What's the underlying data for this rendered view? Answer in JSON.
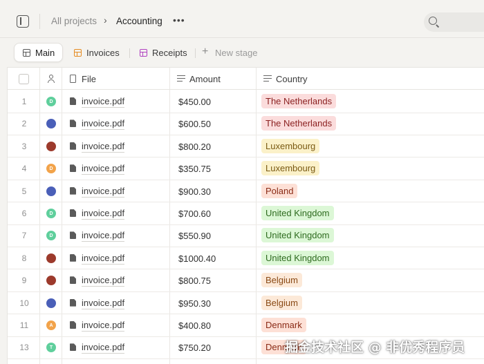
{
  "header": {
    "breadcrumb_root": "All projects",
    "breadcrumb_sep": "›",
    "breadcrumb_current": "Accounting",
    "more_glyph": "•••"
  },
  "tabs": [
    {
      "label": "Main",
      "active": true,
      "icon": "table-icon",
      "color": "#555555"
    },
    {
      "label": "Invoices",
      "active": false,
      "icon": "table-icon",
      "color": "#e58a1f"
    },
    {
      "label": "Receipts",
      "active": false,
      "icon": "table-icon",
      "color": "#b03fc0"
    }
  ],
  "new_stage": {
    "glyph": "+",
    "label": "New stage"
  },
  "columns": {
    "file": "File",
    "amount": "Amount",
    "country": "Country"
  },
  "rows": [
    {
      "num": "1",
      "initial": "D",
      "avatar_color": "#5fcf9c",
      "file": "invoice.pdf",
      "amount": "$450.00",
      "country": "The Netherlands",
      "bg": "#fbdcdc",
      "fg": "#8a1f1f"
    },
    {
      "num": "2",
      "initial": "",
      "avatar_color": "#4a5fb8",
      "file": "invoice.pdf",
      "amount": "$600.50",
      "country": "The Netherlands",
      "bg": "#fbdcdc",
      "fg": "#8a1f1f"
    },
    {
      "num": "3",
      "initial": "",
      "avatar_color": "#9c3a2c",
      "file": "invoice.pdf",
      "amount": "$800.20",
      "country": "Luxembourg",
      "bg": "#fbf1c9",
      "fg": "#7a5a12"
    },
    {
      "num": "4",
      "initial": "D",
      "avatar_color": "#f2a34a",
      "file": "invoice.pdf",
      "amount": "$350.75",
      "country": "Luxembourg",
      "bg": "#fbf1c9",
      "fg": "#7a5a12"
    },
    {
      "num": "5",
      "initial": "",
      "avatar_color": "#4a5fb8",
      "file": "invoice.pdf",
      "amount": "$900.30",
      "country": "Poland",
      "bg": "#fde0d6",
      "fg": "#8a2a15"
    },
    {
      "num": "6",
      "initial": "D",
      "avatar_color": "#5fcf9c",
      "file": "invoice.pdf",
      "amount": "$700.60",
      "country": "United Kingdom",
      "bg": "#dcf7d6",
      "fg": "#2e6b1f"
    },
    {
      "num": "7",
      "initial": "D",
      "avatar_color": "#5fcf9c",
      "file": "invoice.pdf",
      "amount": "$550.90",
      "country": "United Kingdom",
      "bg": "#dcf7d6",
      "fg": "#2e6b1f"
    },
    {
      "num": "8",
      "initial": "",
      "avatar_color": "#9c3a2c",
      "file": "invoice.pdf",
      "amount": "$1000.40",
      "country": "United Kingdom",
      "bg": "#dcf7d6",
      "fg": "#2e6b1f"
    },
    {
      "num": "9",
      "initial": "",
      "avatar_color": "#9c3a2c",
      "file": "invoice.pdf",
      "amount": "$800.75",
      "country": "Belgium",
      "bg": "#fce9d8",
      "fg": "#8a4a15"
    },
    {
      "num": "10",
      "initial": "",
      "avatar_color": "#4a5fb8",
      "file": "invoice.pdf",
      "amount": "$950.30",
      "country": "Belgium",
      "bg": "#fce9d8",
      "fg": "#8a4a15"
    },
    {
      "num": "11",
      "initial": "A",
      "avatar_color": "#f2a34a",
      "file": "invoice.pdf",
      "amount": "$400.80",
      "country": "Denmark",
      "bg": "#fde0d6",
      "fg": "#8a2a15"
    },
    {
      "num": "13",
      "initial": "T",
      "avatar_color": "#5fcf9c",
      "file": "invoice.pdf",
      "amount": "$750.20",
      "country": "Denmark",
      "bg": "#fde0d6",
      "fg": "#8a2a15"
    }
  ],
  "watermark": "掘金技术社区 @ 非优秀程序员"
}
